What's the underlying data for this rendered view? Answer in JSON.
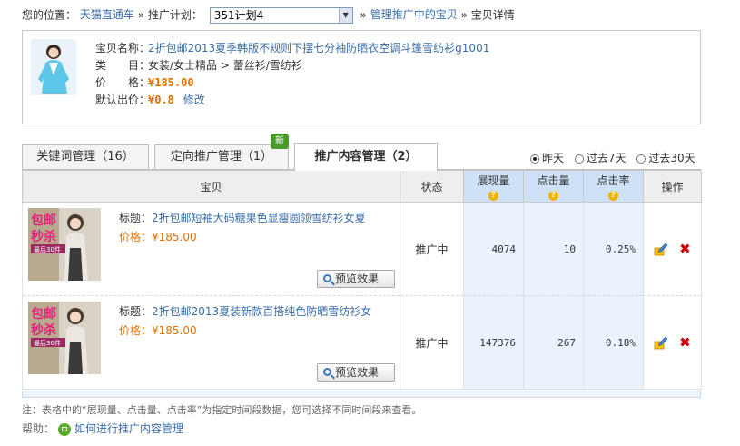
{
  "breadcrumb": {
    "location_label": "您的位置：",
    "home": "天猫直通车",
    "sep": "»",
    "plan_label": "推广计划：",
    "plan_selected": "351计划4",
    "manage_link": "管理推广中的宝贝",
    "current": "宝贝详情"
  },
  "product": {
    "name_label": "宝贝名称：",
    "name": "2折包邮2013夏季韩版不规则下摆七分袖防晒衣空调斗篷雪纺衫g1001",
    "category_label": "类　　目：",
    "category": "女装/女士精品 > 蕾丝衫/雪纺衫",
    "price_label": "价　　格：",
    "price": "¥185.00",
    "bid_label": "默认出价：",
    "bid": "¥0.8",
    "edit_link": "修改"
  },
  "tabs": [
    {
      "label": "关键词管理（16）"
    },
    {
      "label": "定向推广管理（1）"
    },
    {
      "label": "推广内容管理（2）"
    }
  ],
  "new_badge": "新",
  "time_options": [
    "昨天",
    "过去7天",
    "过去30天"
  ],
  "table": {
    "headers": {
      "item": "宝贝",
      "status": "状态",
      "impressions": "展现量",
      "clicks": "点击量",
      "ctr": "点击率",
      "actions": "操作"
    },
    "rows": [
      {
        "thumb_top": "包邮",
        "thumb_mid": "秒杀",
        "thumb_small": "最后30件",
        "title_label": "标题：",
        "title": "2折包邮短袖大码糖果色显瘦圆领雪纺衫女夏",
        "price_label": "价格：",
        "price": "¥185.00",
        "preview": "预览效果",
        "status": "推广中",
        "impressions": "4074",
        "clicks": "10",
        "ctr": "0.25%"
      },
      {
        "thumb_top": "包邮",
        "thumb_mid": "秒杀",
        "thumb_small": "最后30件",
        "title_label": "标题：",
        "title": "2折包邮2013夏装新款百搭纯色防晒雪纺衫女",
        "price_label": "价格：",
        "price": "¥185.00",
        "preview": "预览效果",
        "status": "推广中",
        "impressions": "147376",
        "clicks": "267",
        "ctr": "0.18%"
      }
    ]
  },
  "note": "注：表格中的“展现量、点击量、点击率”为指定时间段数据，您可选择不同时间段来查看。",
  "help": {
    "label": "帮助：",
    "link": "如何进行推广内容管理"
  },
  "colors": {
    "link": "#3a6da8",
    "price": "#e07000",
    "metric_header": "#cfe1f7",
    "metric_cell": "#eaf3fd",
    "badge": "#4b9a2c",
    "delete": "#d40000"
  }
}
